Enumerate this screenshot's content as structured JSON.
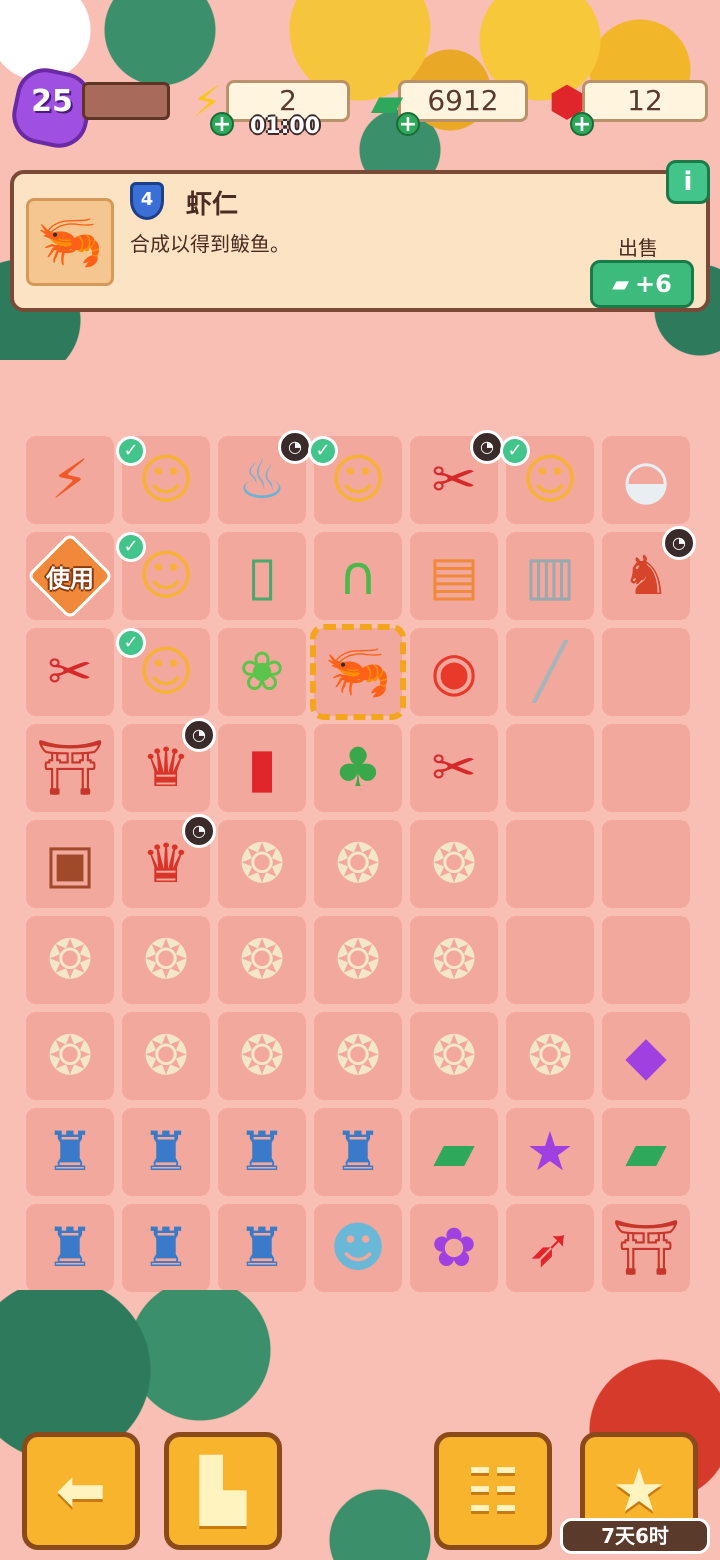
{
  "header": {
    "level": "25",
    "energy": "2",
    "energy_timer": "01:00",
    "cash": "6912",
    "gems": "12"
  },
  "info_panel": {
    "item_level": "4",
    "item_name": "虾仁",
    "item_description": "合成以得到鲅鱼。",
    "sell_label": "出售",
    "sell_value": "+6",
    "info_glyph": "i"
  },
  "board": {
    "use_label": "使用",
    "selected_item": "shrimp"
  },
  "footer": {
    "event_timer": "7天6时"
  },
  "colors": {
    "background": "#f9bfb4",
    "cell": "#f2a89c",
    "panel": "#fbe3c4",
    "accent_green": "#3dbb7c",
    "nav_button": "#f9b42e"
  }
}
